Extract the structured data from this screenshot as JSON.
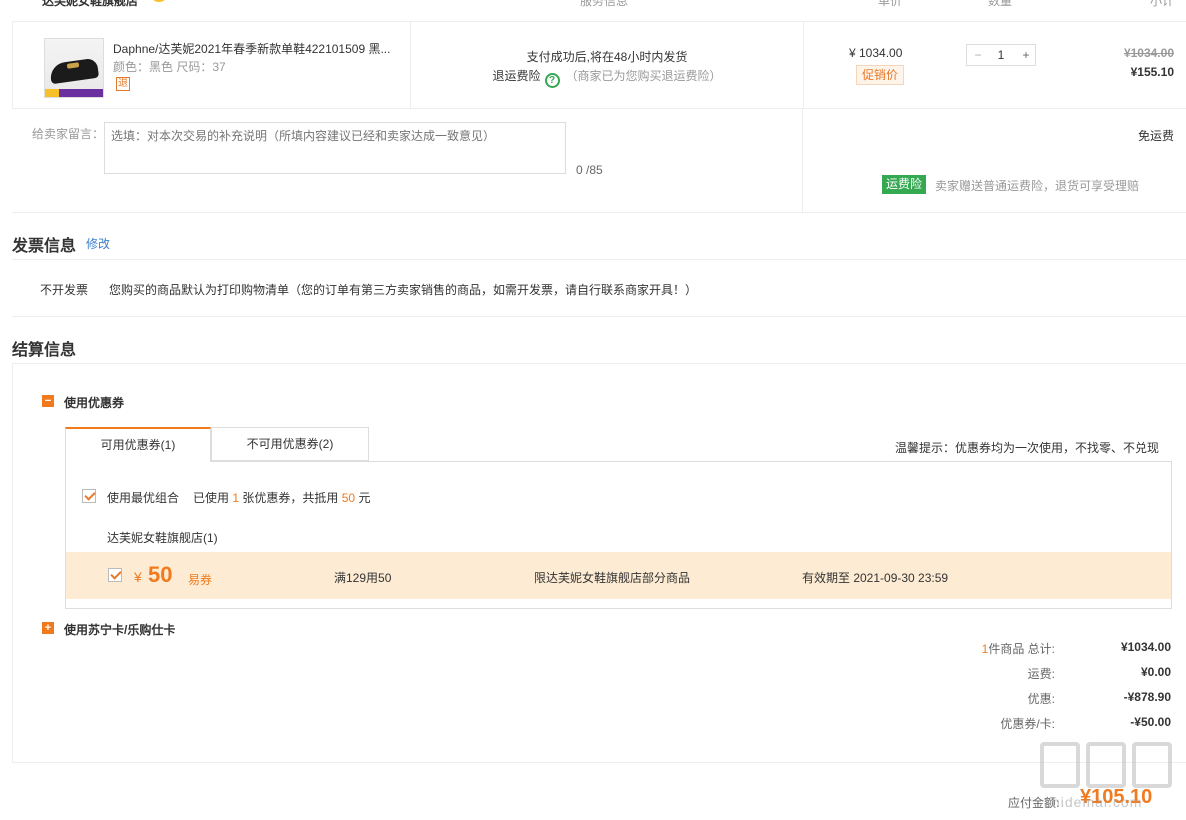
{
  "header": {
    "shop_name": "达芙妮女鞋旗舰店",
    "col_service": "服务信息",
    "col_price": "单价",
    "col_qty": "数量",
    "col_subtotal": "小计"
  },
  "product": {
    "title": "Daphne/达芙妮2021年春季新款单鞋422101509 黑...",
    "spec": "颜色：黑色   尺码：37",
    "return_tag": "退",
    "service_line1": "支付成功后,将在48小时内发货",
    "service_insurance": "退运费险",
    "service_note": "（商家已为您购买退运费险）",
    "unit_price": "¥ 1034.00",
    "promo_tag": "促销价",
    "qty": "1",
    "qty_minus": "−",
    "qty_plus": "+",
    "orig_total": "¥1034.00",
    "subtotal": "¥155.10"
  },
  "message": {
    "label": "给卖家留言：",
    "placeholder": "选填：对本次交易的补充说明（所填内容建议已经和卖家达成一致意见）",
    "count": "0 /85",
    "free_shipping": "免运费",
    "ins_tag": "运费险",
    "ins_text": "卖家赠送普通运费险，退货可享受理赔"
  },
  "invoice": {
    "title": "发票信息",
    "edit_link": "修改",
    "type": "不开发票",
    "desc": "您购买的商品默认为打印购物清单（您的订单有第三方卖家销售的商品，如需开发票，请自行联系商家开具！）"
  },
  "settlement": {
    "title": "结算信息",
    "use_coupon": "使用优惠券",
    "tab_available": "可用优惠券(1)",
    "tab_unavailable": "不可用优惠券(2)",
    "tip": "温馨提示：优惠券均为一次使用，不找零、不兑现",
    "best_combo": "使用最优组合",
    "used_prefix": "已使用",
    "used_count": "1",
    "used_mid": "张优惠券，共抵用",
    "used_amount": "50",
    "used_suffix": "元",
    "store": "达芙妮女鞋旗舰店(1)",
    "coupon": {
      "yen": "¥",
      "amount": "50",
      "type": "易券",
      "condition": "满129用50",
      "scope": "限达芙妮女鞋旗舰店部分商品",
      "expiry": "有效期至 2021-09-30 23:59"
    },
    "use_card": "使用苏宁卡/乐购仕卡",
    "summary": {
      "item_count": "1",
      "total_label": "件商品 总计:",
      "total": "¥1034.00",
      "shipping_label": "运费:",
      "shipping": "¥0.00",
      "discount_label": "优惠:",
      "discount": "-¥878.90",
      "coupon_label": "优惠券/卡:",
      "coupon": "-¥50.00"
    },
    "pay_label": "应付金额:",
    "pay_amount": "¥105.10"
  },
  "watermark": {
    "text": "zhidemai.com"
  },
  "colors": {
    "accent": "#f07a1d",
    "green": "#35a852",
    "link": "#3b7fce",
    "coupon_bg": "#fdecd3"
  },
  "icons": {
    "help": "help-circle-icon",
    "collapse": "minus-square-icon",
    "expand": "plus-square-icon",
    "check": "checkmark-icon"
  }
}
